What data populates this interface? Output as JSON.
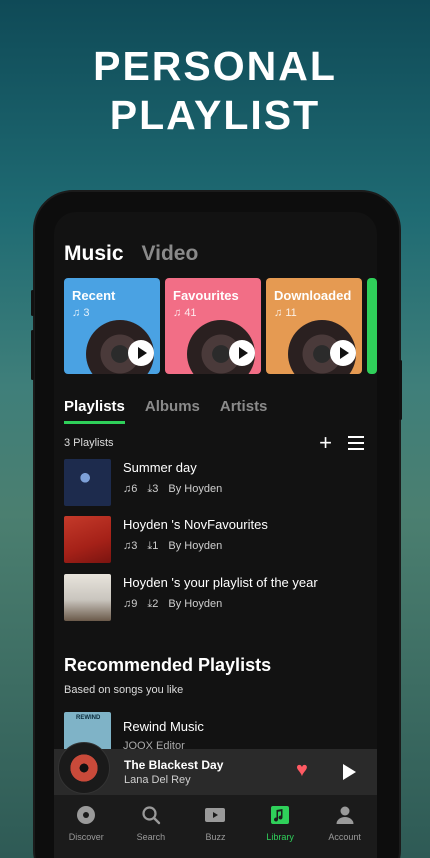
{
  "headline": {
    "line1": "PERSONAL",
    "line2": "PLAYLIST"
  },
  "top_tabs": [
    {
      "label": "Music",
      "active": true
    },
    {
      "label": "Video",
      "active": false
    }
  ],
  "cards": [
    {
      "title": "Recent",
      "count": "3",
      "color": "#4aa2e3"
    },
    {
      "title": "Favourites",
      "count": "41",
      "color": "#f26e86"
    },
    {
      "title": "Downloaded",
      "count": "11",
      "color": "#e59a52"
    },
    {
      "title": "",
      "count": "",
      "color": "#2fd05a"
    }
  ],
  "sub_tabs": [
    {
      "label": "Playlists",
      "active": true
    },
    {
      "label": "Albums",
      "active": false
    },
    {
      "label": "Artists",
      "active": false
    }
  ],
  "playlist_count": "3 Playlists",
  "playlists": [
    {
      "title": "Summer day",
      "songs": "6",
      "downloads": "3",
      "by": "By Hoyden",
      "thumb_color": "#1d2b4d"
    },
    {
      "title": "Hoyden 's NovFavourites",
      "songs": "3",
      "downloads": "1",
      "by": "By Hoyden",
      "thumb_color": "#b82a1f"
    },
    {
      "title": "Hoyden 's your playlist of the year",
      "songs": "9",
      "downloads": "2",
      "by": "By Hoyden",
      "thumb_color": "#c9c5be"
    }
  ],
  "recommended": {
    "title": "Recommended Playlists",
    "subtitle": "Based on songs you like",
    "item": {
      "name": "Rewind Music",
      "editor": "JOOX Editor",
      "thumb_label": "REWIND"
    }
  },
  "now_playing": {
    "title": "The Blackest Day",
    "artist": "Lana Del Rey"
  },
  "nav": [
    {
      "label": "Discover",
      "icon": "disc-icon",
      "active": false
    },
    {
      "label": "Search",
      "icon": "search-icon",
      "active": false
    },
    {
      "label": "Buzz",
      "icon": "video-icon",
      "active": false
    },
    {
      "label": "Library",
      "icon": "music-library-icon",
      "active": true
    },
    {
      "label": "Account",
      "icon": "person-icon",
      "active": false
    }
  ],
  "colors": {
    "accent": "#2fd05a",
    "heart": "#ff5a63"
  }
}
